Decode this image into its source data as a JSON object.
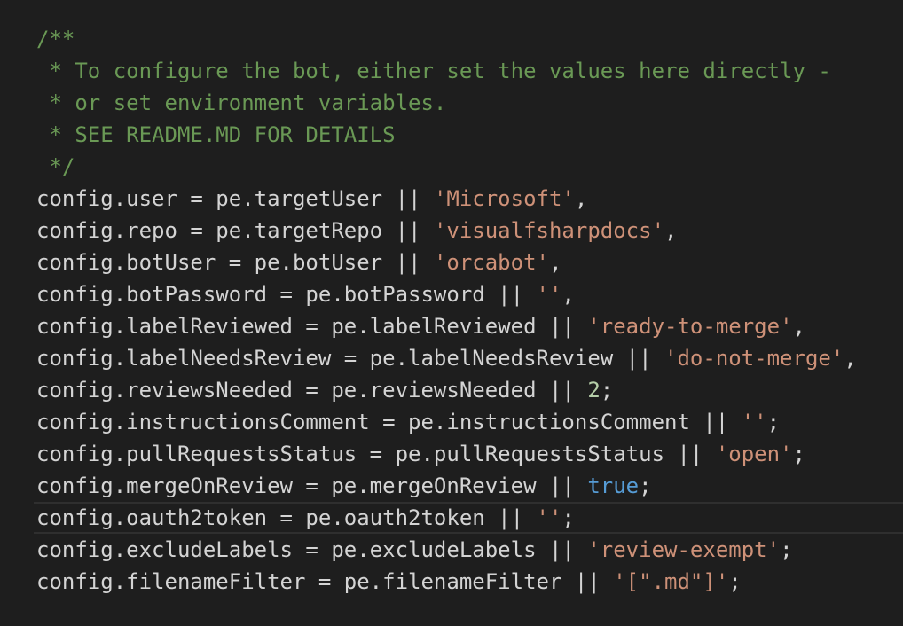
{
  "editor": {
    "current_line_index": 15,
    "colors": {
      "background": "#1e1e1e",
      "comment": "#6a9955",
      "plain": "#d4d4d4",
      "string": "#ce9178",
      "number": "#b5cea8",
      "keyword": "#569cd6",
      "current_line_border": "#2f2f2f"
    },
    "lines": [
      {
        "tokens": [
          {
            "t": "comment",
            "v": "/**"
          }
        ]
      },
      {
        "tokens": [
          {
            "t": "comment",
            "v": " * To configure the bot, either set the values here directly -"
          }
        ]
      },
      {
        "tokens": [
          {
            "t": "comment",
            "v": " * or set environment variables."
          }
        ]
      },
      {
        "tokens": [
          {
            "t": "comment",
            "v": " * SEE README.MD FOR DETAILS"
          }
        ]
      },
      {
        "tokens": [
          {
            "t": "comment",
            "v": " */"
          }
        ]
      },
      {
        "tokens": [
          {
            "t": "plain",
            "v": "config.user = pe.targetUser || "
          },
          {
            "t": "string",
            "v": "'Microsoft'"
          },
          {
            "t": "plain",
            "v": ","
          }
        ]
      },
      {
        "tokens": [
          {
            "t": "plain",
            "v": "config.repo = pe.targetRepo || "
          },
          {
            "t": "string",
            "v": "'visualfsharpdocs'"
          },
          {
            "t": "plain",
            "v": ","
          }
        ]
      },
      {
        "tokens": [
          {
            "t": "plain",
            "v": "config.botUser = pe.botUser || "
          },
          {
            "t": "string",
            "v": "'orcabot'"
          },
          {
            "t": "plain",
            "v": ","
          }
        ]
      },
      {
        "tokens": [
          {
            "t": "plain",
            "v": "config.botPassword = pe.botPassword || "
          },
          {
            "t": "string",
            "v": "''"
          },
          {
            "t": "plain",
            "v": ","
          }
        ]
      },
      {
        "tokens": [
          {
            "t": "plain",
            "v": "config.labelReviewed = pe.labelReviewed || "
          },
          {
            "t": "string",
            "v": "'ready-to-merge'"
          },
          {
            "t": "plain",
            "v": ","
          }
        ]
      },
      {
        "tokens": [
          {
            "t": "plain",
            "v": "config.labelNeedsReview = pe.labelNeedsReview || "
          },
          {
            "t": "string",
            "v": "'do-not-merge'"
          },
          {
            "t": "plain",
            "v": ","
          }
        ]
      },
      {
        "tokens": [
          {
            "t": "plain",
            "v": "config.reviewsNeeded = pe.reviewsNeeded || "
          },
          {
            "t": "number",
            "v": "2"
          },
          {
            "t": "plain",
            "v": ";"
          }
        ]
      },
      {
        "tokens": [
          {
            "t": "plain",
            "v": "config.instructionsComment = pe.instructionsComment || "
          },
          {
            "t": "string",
            "v": "''"
          },
          {
            "t": "plain",
            "v": ";"
          }
        ]
      },
      {
        "tokens": [
          {
            "t": "plain",
            "v": "config.pullRequestsStatus = pe.pullRequestsStatus || "
          },
          {
            "t": "string",
            "v": "'open'"
          },
          {
            "t": "plain",
            "v": ";"
          }
        ]
      },
      {
        "tokens": [
          {
            "t": "plain",
            "v": "config.mergeOnReview = pe.mergeOnReview || "
          },
          {
            "t": "keyword",
            "v": "true"
          },
          {
            "t": "plain",
            "v": ";"
          }
        ]
      },
      {
        "tokens": [
          {
            "t": "plain",
            "v": "config.oauth2token = pe.oauth2token || "
          },
          {
            "t": "string",
            "v": "''"
          },
          {
            "t": "plain",
            "v": ";"
          }
        ]
      },
      {
        "tokens": [
          {
            "t": "plain",
            "v": "config.excludeLabels = pe.excludeLabels || "
          },
          {
            "t": "string",
            "v": "'review-exempt'"
          },
          {
            "t": "plain",
            "v": ";"
          }
        ]
      },
      {
        "tokens": [
          {
            "t": "plain",
            "v": "config.filenameFilter = pe.filenameFilter || "
          },
          {
            "t": "string",
            "v": "'[\".md\"]'"
          },
          {
            "t": "plain",
            "v": ";"
          }
        ]
      }
    ]
  }
}
